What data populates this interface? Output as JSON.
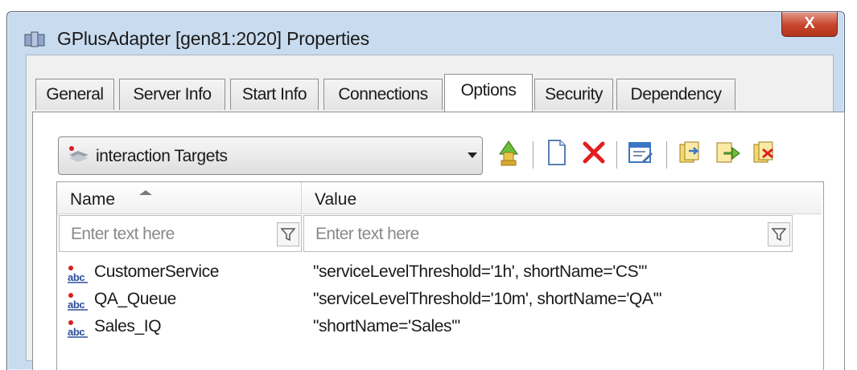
{
  "window": {
    "title": "GPlusAdapter [gen81:2020] Properties",
    "close_label": "X"
  },
  "tabs": [
    {
      "label": "General"
    },
    {
      "label": "Server Info"
    },
    {
      "label": "Start Info"
    },
    {
      "label": "Connections"
    },
    {
      "label": "Options",
      "active": true
    },
    {
      "label": "Security"
    },
    {
      "label": "Dependency"
    }
  ],
  "section_select": {
    "value": "interaction Targets"
  },
  "toolbar": [
    "move-up-icon",
    "new-document-icon",
    "delete-icon",
    "edit-properties-icon",
    "copy-icon",
    "export-icon",
    "import-icon"
  ],
  "grid": {
    "columns": {
      "name": "Name",
      "value": "Value"
    },
    "filters": {
      "name_placeholder": "Enter text here",
      "value_placeholder": "Enter text here"
    },
    "rows": [
      {
        "name": "CustomerService",
        "value": "\"serviceLevelThreshold='1h', shortName='CS'\""
      },
      {
        "name": "QA_Queue",
        "value": "\"serviceLevelThreshold='10m', shortName='QA'\""
      },
      {
        "name": "Sales_IQ",
        "value": "\"shortName='Sales'\""
      }
    ]
  },
  "colors": {
    "title_bar": "#c9dbee",
    "close_button": "#c7452c",
    "delete_red": "#e02020",
    "accent_blue": "#3a76c4"
  }
}
